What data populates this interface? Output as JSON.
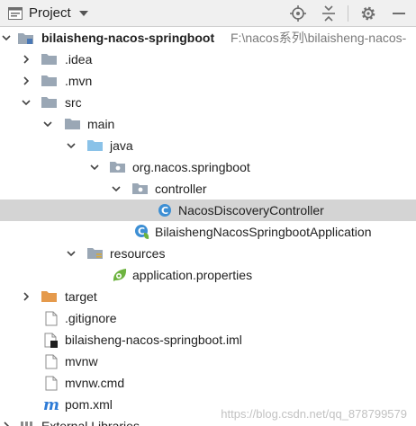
{
  "header": {
    "title": "Project",
    "colors": {
      "background": "#f0f0f0",
      "icon": "#6e6e6e"
    },
    "icons": [
      "project-view-icon",
      "chevron-down-icon",
      "locate-icon",
      "collapse-all-icon",
      "gear-icon",
      "minimize-icon"
    ]
  },
  "tree": {
    "colors": {
      "selected_row": "#d4d4d4",
      "folder": "#9aa7b5",
      "source_folder": "#8ac2e8",
      "excluded_folder": "#e59a4c",
      "path": "#7a7a7a"
    },
    "items": [
      {
        "label": "bilaisheng-nacos-springboot",
        "path": "F:\\nacos系列\\bilaisheng-nacos-",
        "expanded": true,
        "icon": "module-folder-icon"
      },
      {
        "label": ".idea",
        "expanded": false,
        "icon": "folder-icon"
      },
      {
        "label": ".mvn",
        "expanded": false,
        "icon": "folder-icon"
      },
      {
        "label": "src",
        "expanded": true,
        "icon": "folder-icon"
      },
      {
        "label": "main",
        "expanded": true,
        "icon": "folder-icon"
      },
      {
        "label": "java",
        "expanded": true,
        "icon": "source-folder-icon"
      },
      {
        "label": "org.nacos.springboot",
        "expanded": true,
        "icon": "package-icon"
      },
      {
        "label": "controller",
        "expanded": true,
        "icon": "package-icon"
      },
      {
        "label": "NacosDiscoveryController",
        "icon": "java-class-icon",
        "selected": true
      },
      {
        "label": "BilaishengNacosSpringbootApplication",
        "icon": "spring-boot-app-icon"
      },
      {
        "label": "resources",
        "expanded": true,
        "icon": "resources-folder-icon"
      },
      {
        "label": "application.properties",
        "icon": "spring-properties-icon"
      },
      {
        "label": "target",
        "expanded": false,
        "icon": "excluded-folder-icon"
      },
      {
        "label": ".gitignore",
        "icon": "text-file-icon"
      },
      {
        "label": "bilaisheng-nacos-springboot.iml",
        "icon": "iml-file-icon"
      },
      {
        "label": "mvnw",
        "icon": "text-file-icon"
      },
      {
        "label": "mvnw.cmd",
        "icon": "text-file-icon"
      },
      {
        "label": "pom.xml",
        "icon": "maven-icon"
      },
      {
        "label": "External Libraries",
        "expanded": false,
        "icon": "libraries-icon"
      }
    ]
  },
  "watermark": "https://blog.csdn.net/qq_878799579"
}
